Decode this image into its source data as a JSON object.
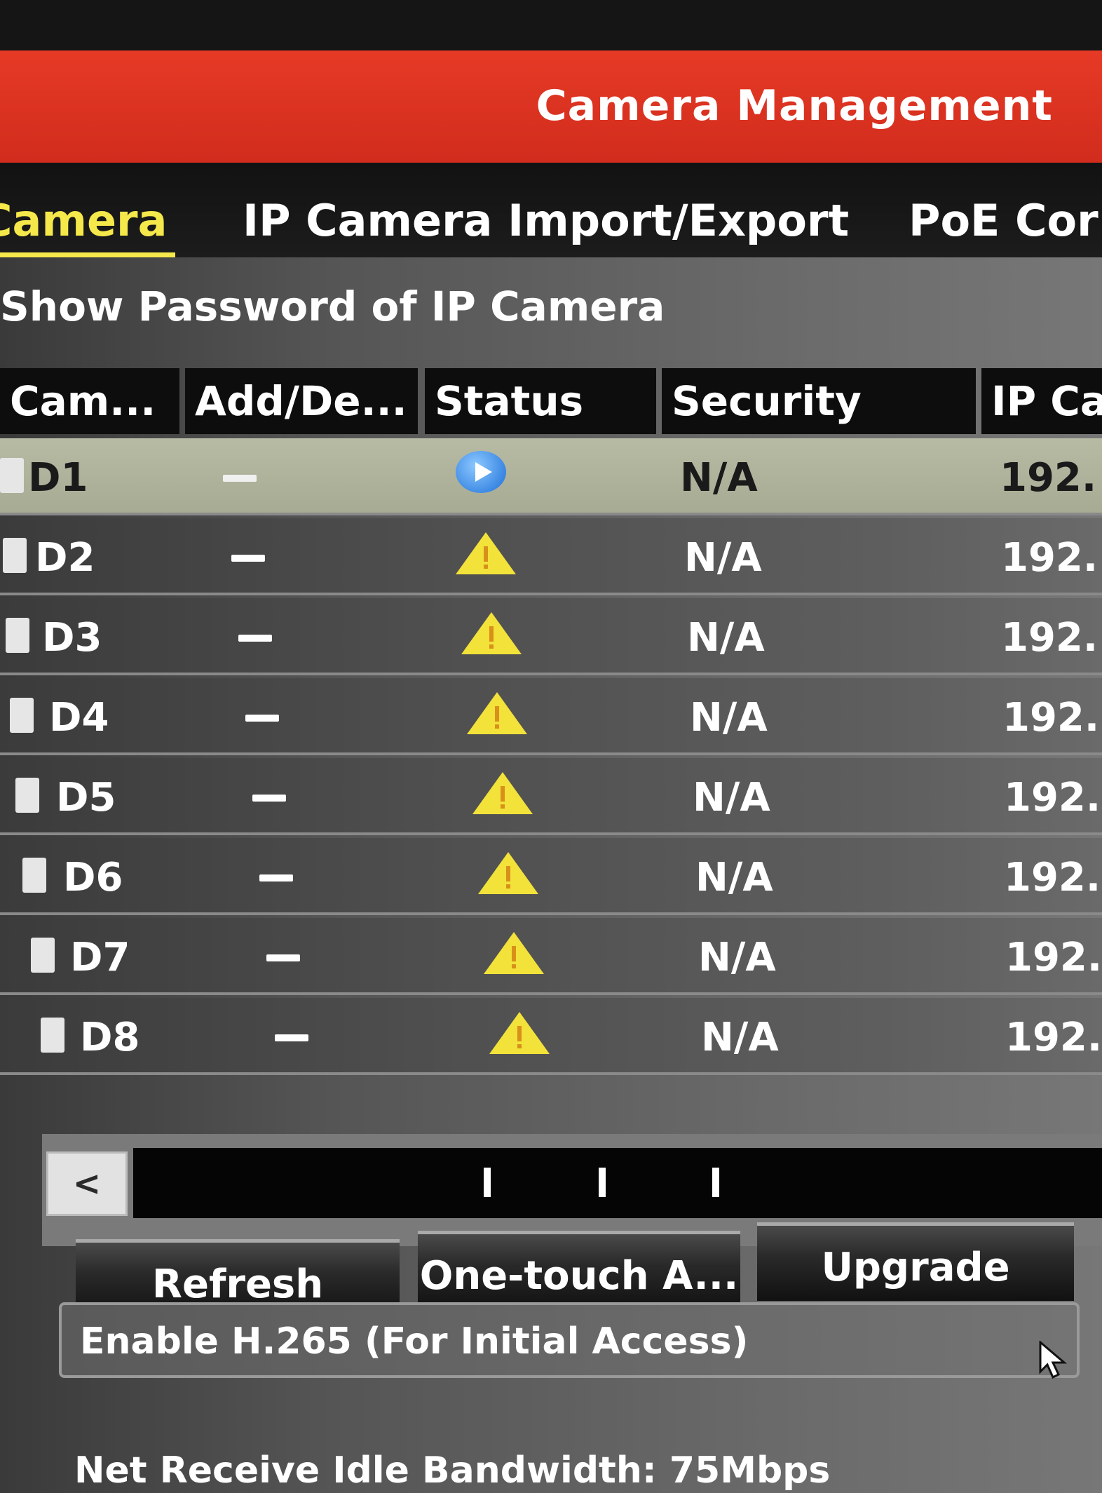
{
  "header": {
    "title": "Camera Management"
  },
  "tabs": [
    {
      "label": "Camera",
      "visible_text": "Camera",
      "active": true
    },
    {
      "label": "IP Camera Import/Export"
    },
    {
      "label": "PoE Cor"
    }
  ],
  "options": {
    "show_password": "Show Password of IP Camera"
  },
  "table": {
    "columns": [
      "Cam...",
      "Add/De...",
      "Status",
      "Security",
      "IP Ca"
    ],
    "rows": [
      {
        "camera": "D1",
        "add_delete": "—",
        "status": "playing",
        "security": "N/A",
        "ip": "192."
      },
      {
        "camera": "D2",
        "add_delete": "—",
        "status": "warning",
        "security": "N/A",
        "ip": "192."
      },
      {
        "camera": "D3",
        "add_delete": "—",
        "status": "warning",
        "security": "N/A",
        "ip": "192."
      },
      {
        "camera": "D4",
        "add_delete": "—",
        "status": "warning",
        "security": "N/A",
        "ip": "192."
      },
      {
        "camera": "D5",
        "add_delete": "—",
        "status": "warning",
        "security": "N/A",
        "ip": "192."
      },
      {
        "camera": "D6",
        "add_delete": "—",
        "status": "warning",
        "security": "N/A",
        "ip": "192."
      },
      {
        "camera": "D7",
        "add_delete": "—",
        "status": "warning",
        "security": "N/A",
        "ip": "192."
      },
      {
        "camera": "D8",
        "add_delete": "—",
        "status": "warning",
        "security": "N/A",
        "ip": "192."
      }
    ]
  },
  "scrollbar": {
    "left_arrow": "<"
  },
  "buttons": {
    "refresh": "Refresh",
    "one_touch": "One-touch A...",
    "upgrade": "Upgrade"
  },
  "h265": {
    "label": "Enable H.265 (For Initial Access)"
  },
  "footer": {
    "bandwidth": "Net Receive Idle Bandwidth: 75Mbps"
  },
  "colors": {
    "header_red": "#e63a26",
    "active_tab": "#f5e84a",
    "warning": "#f2e23a",
    "play": "#1c6fd8"
  },
  "icons": {
    "warning": "warning-triangle-icon",
    "play": "play-icon",
    "cursor": "mouse-pointer-icon"
  }
}
